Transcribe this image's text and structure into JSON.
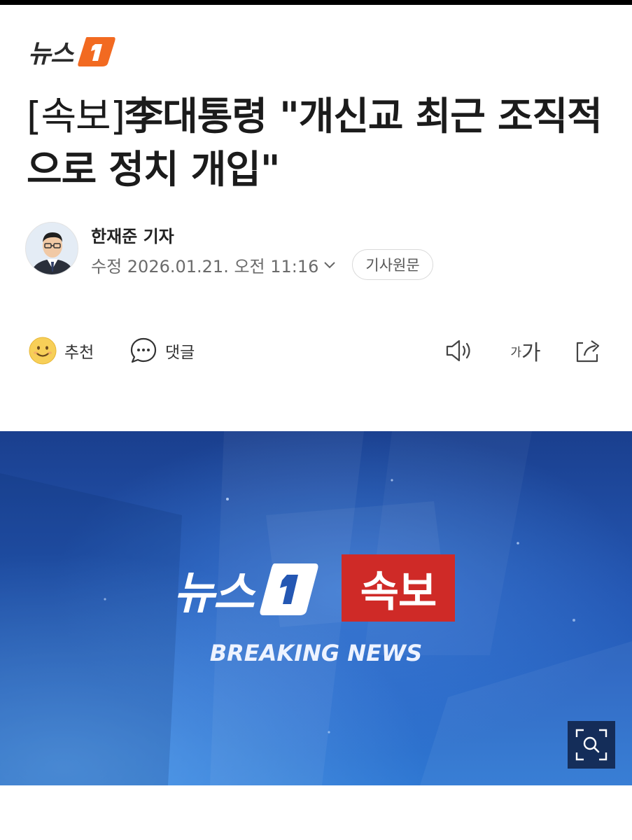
{
  "brand": {
    "name": "뉴스",
    "badge": "1"
  },
  "article": {
    "headline_prefix": "[속보]",
    "headline_main": "李대통령 \"개신교 최근 조직적으로 정치 개입\"",
    "reporter": "한재준 기자",
    "date": "수정 2026.01.21. 오전 11:16",
    "original_button": "기사원문"
  },
  "actions": {
    "recommend": "추천",
    "comment": "댓글",
    "fontsize_small": "가",
    "fontsize_big": "가"
  },
  "banner": {
    "brand": "뉴스",
    "badge": "속보",
    "subtitle": "BREAKING NEWS"
  },
  "colors": {
    "brand_orange": "#f26a21",
    "breaking_red": "#cf2a27",
    "banner_blue": "#2457b3"
  },
  "icons": [
    "smile-icon",
    "comment-icon",
    "speaker-icon",
    "font-size-icon",
    "share-icon",
    "chevron-down-icon",
    "zoom-icon"
  ]
}
